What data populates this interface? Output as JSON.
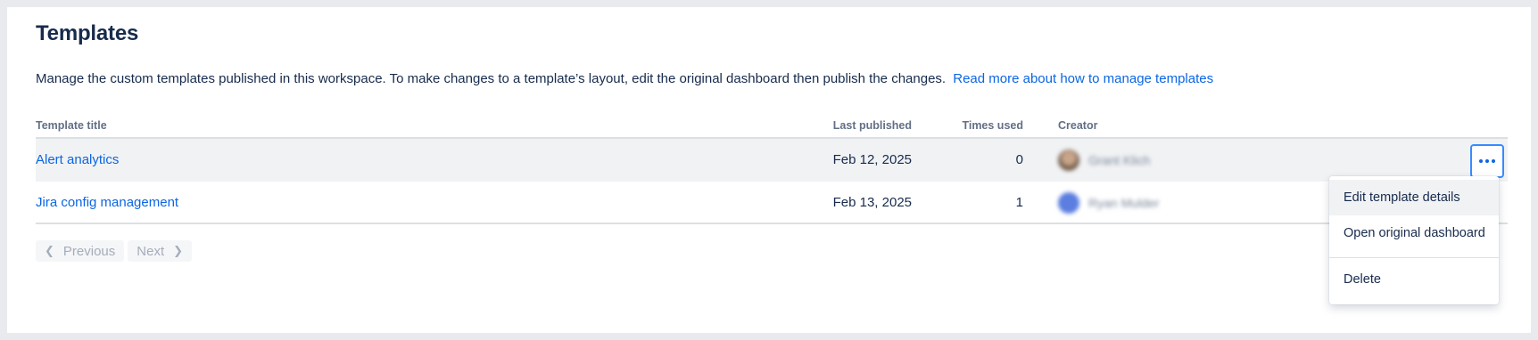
{
  "page": {
    "title": "Templates",
    "description": "Manage the custom templates published in this workspace. To make changes to a template’s layout, edit the original dashboard then publish the changes.",
    "help_link": "Read more about how to manage templates"
  },
  "table": {
    "headers": {
      "title": "Template title",
      "last_published": "Last published",
      "times_used": "Times used",
      "creator": "Creator"
    },
    "rows": [
      {
        "title": "Alert analytics",
        "last_published": "Feb 12, 2025",
        "times_used": "0",
        "creator": "Grant Klich"
      },
      {
        "title": "Jira config management",
        "last_published": "Feb 13, 2025",
        "times_used": "1",
        "creator": "Ryan Mulder"
      }
    ]
  },
  "pagination": {
    "previous": "Previous",
    "next": "Next"
  },
  "actions_menu": {
    "items": [
      "Edit template details",
      "Open original dashboard",
      "Delete"
    ]
  },
  "colors": {
    "accent": "#0c66e4",
    "focus_ring": "#388bff",
    "text": "#172b4d",
    "subtle_text": "#626f86"
  }
}
